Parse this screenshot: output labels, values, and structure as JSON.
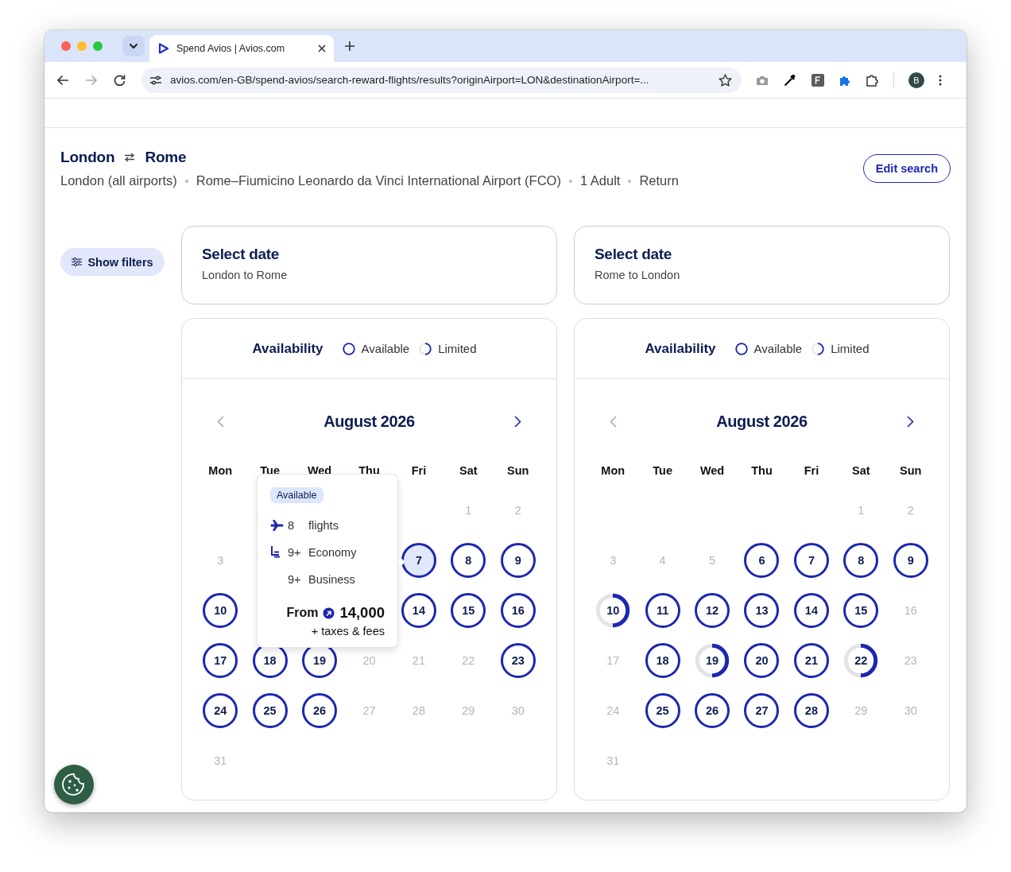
{
  "browser": {
    "tab": {
      "title": "Spend Avios | Avios.com",
      "selected": true
    },
    "address": "avios.com/en-GB/spend-avios/search-reward-flights/results?originAirport=LON&destinationAirport=...",
    "avatar": "B"
  },
  "route": {
    "origin": "London",
    "destination": "Rome",
    "details": [
      "London (all airports)",
      "Rome–Fiumicino Leonardo da Vinci International Airport (FCO)",
      "1 Adult",
      "Return"
    ]
  },
  "edit_button": "Edit search",
  "filters_button": "Show filters",
  "journeys": [
    {
      "title": "Select date",
      "subtitle": "London to Rome",
      "legend": {
        "title": "Availability",
        "items": [
          {
            "kind": "available",
            "label": "Available"
          },
          {
            "kind": "limited",
            "label": "Limited"
          }
        ]
      },
      "month": "August 2026",
      "prev_disabled": true,
      "weekdays": [
        "Mon",
        "Tue",
        "Wed",
        "Thu",
        "Fri",
        "Sat",
        "Sun"
      ],
      "days": [
        {
          "kind": "blank"
        },
        {
          "kind": "blank"
        },
        {
          "kind": "blank"
        },
        {
          "kind": "blank"
        },
        {
          "kind": "blank"
        },
        {
          "day": "1",
          "kind": "none",
          "selected": false
        },
        {
          "day": "2",
          "kind": "none",
          "selected": false
        },
        {
          "day": "3",
          "kind": "none",
          "selected": false
        },
        {
          "kind": "covered"
        },
        {
          "kind": "covered"
        },
        {
          "kind": "covered"
        },
        {
          "day": "7",
          "kind": "available",
          "selected": true
        },
        {
          "day": "8",
          "kind": "available",
          "selected": false
        },
        {
          "day": "9",
          "kind": "available",
          "selected": false
        },
        {
          "day": "10",
          "kind": "available",
          "selected": false
        },
        {
          "kind": "covered"
        },
        {
          "kind": "covered"
        },
        {
          "kind": "covered"
        },
        {
          "day": "14",
          "kind": "available",
          "selected": false
        },
        {
          "day": "15",
          "kind": "available",
          "selected": false
        },
        {
          "day": "16",
          "kind": "available",
          "selected": false
        },
        {
          "day": "17",
          "kind": "available",
          "selected": false
        },
        {
          "day": "18",
          "kind": "available",
          "selected": false
        },
        {
          "day": "19",
          "kind": "available",
          "selected": false
        },
        {
          "day": "20",
          "kind": "none",
          "selected": false
        },
        {
          "day": "21",
          "kind": "none",
          "selected": false
        },
        {
          "day": "22",
          "kind": "none",
          "selected": false
        },
        {
          "day": "23",
          "kind": "available",
          "selected": false
        },
        {
          "day": "24",
          "kind": "available",
          "selected": false
        },
        {
          "day": "25",
          "kind": "available",
          "selected": false
        },
        {
          "day": "26",
          "kind": "available",
          "selected": false
        },
        {
          "day": "27",
          "kind": "none",
          "selected": false
        },
        {
          "day": "28",
          "kind": "none",
          "selected": false
        },
        {
          "day": "29",
          "kind": "none",
          "selected": false
        },
        {
          "day": "30",
          "kind": "none",
          "selected": false
        },
        {
          "day": "31",
          "kind": "none",
          "selected": false
        }
      ],
      "tooltip": {
        "badge": "Available",
        "rows": [
          {
            "kind": "flights",
            "count": "8",
            "label": "flights"
          },
          {
            "kind": "economy",
            "count": "9+",
            "label": "Economy"
          },
          {
            "kind": "business",
            "count": "9+",
            "label": "Business"
          }
        ],
        "from_label": "From",
        "price": "14,000",
        "note": "+ taxes & fees"
      }
    },
    {
      "title": "Select date",
      "subtitle": "Rome to London",
      "legend": {
        "title": "Availability",
        "items": [
          {
            "kind": "available",
            "label": "Available"
          },
          {
            "kind": "limited",
            "label": "Limited"
          }
        ]
      },
      "month": "August 2026",
      "prev_disabled": true,
      "weekdays": [
        "Mon",
        "Tue",
        "Wed",
        "Thu",
        "Fri",
        "Sat",
        "Sun"
      ],
      "days": [
        {
          "kind": "blank"
        },
        {
          "kind": "blank"
        },
        {
          "kind": "blank"
        },
        {
          "kind": "blank"
        },
        {
          "kind": "blank"
        },
        {
          "day": "1",
          "kind": "none",
          "selected": false
        },
        {
          "day": "2",
          "kind": "none",
          "selected": false
        },
        {
          "day": "3",
          "kind": "none",
          "selected": false
        },
        {
          "day": "4",
          "kind": "none",
          "selected": false
        },
        {
          "day": "5",
          "kind": "none",
          "selected": false
        },
        {
          "day": "6",
          "kind": "available",
          "selected": false
        },
        {
          "day": "7",
          "kind": "available",
          "selected": false
        },
        {
          "day": "8",
          "kind": "available",
          "selected": false
        },
        {
          "day": "9",
          "kind": "available",
          "selected": false
        },
        {
          "day": "10",
          "kind": "limited",
          "selected": false
        },
        {
          "day": "11",
          "kind": "available",
          "selected": false
        },
        {
          "day": "12",
          "kind": "available",
          "selected": false
        },
        {
          "day": "13",
          "kind": "available",
          "selected": false
        },
        {
          "day": "14",
          "kind": "available",
          "selected": false
        },
        {
          "day": "15",
          "kind": "available",
          "selected": false
        },
        {
          "day": "16",
          "kind": "none",
          "selected": false
        },
        {
          "day": "17",
          "kind": "none",
          "selected": false
        },
        {
          "day": "18",
          "kind": "available",
          "selected": false
        },
        {
          "day": "19",
          "kind": "limited",
          "selected": false
        },
        {
          "day": "20",
          "kind": "available",
          "selected": false
        },
        {
          "day": "21",
          "kind": "available",
          "selected": false
        },
        {
          "day": "22",
          "kind": "limited",
          "selected": false
        },
        {
          "day": "23",
          "kind": "none",
          "selected": false
        },
        {
          "day": "24",
          "kind": "none",
          "selected": false
        },
        {
          "day": "25",
          "kind": "available",
          "selected": false
        },
        {
          "day": "26",
          "kind": "available",
          "selected": false
        },
        {
          "day": "27",
          "kind": "available",
          "selected": false
        },
        {
          "day": "28",
          "kind": "available",
          "selected": false
        },
        {
          "day": "29",
          "kind": "none",
          "selected": false
        },
        {
          "day": "30",
          "kind": "none",
          "selected": false
        },
        {
          "day": "31",
          "kind": "none",
          "selected": false
        }
      ]
    }
  ]
}
